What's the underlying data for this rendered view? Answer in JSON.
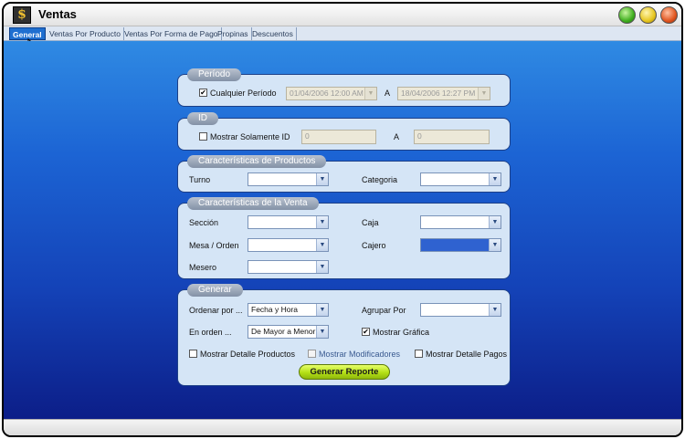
{
  "window": {
    "title": "Ventas",
    "app_icon_glyph": "$"
  },
  "tabs": [
    {
      "label": "General",
      "active": true
    },
    {
      "label": "Ventas Por Producto"
    },
    {
      "label": "Ventas Por Forma de Pago"
    },
    {
      "label": "Propinas"
    },
    {
      "label": "Descuentos"
    }
  ],
  "periodo": {
    "legend": "Período",
    "any_period_label": "Cualquier Período",
    "any_period_checked": true,
    "from_value": "01/04/2006 12:00 AM",
    "to_label": "A",
    "to_value": "18/04/2006 12:27 PM"
  },
  "id": {
    "legend": "ID",
    "only_id_label": "Mostrar Solamente ID",
    "only_id_checked": false,
    "from_value": "0",
    "to_label": "A",
    "to_value": "0"
  },
  "productos": {
    "legend": "Características de Productos",
    "turno_label": "Turno",
    "turno_value": "",
    "categoria_label": "Categoria",
    "categoria_value": ""
  },
  "venta": {
    "legend": "Características de la Venta",
    "seccion_label": "Sección",
    "seccion_value": "",
    "caja_label": "Caja",
    "caja_value": "",
    "mesa_label": "Mesa / Orden",
    "mesa_value": "",
    "cajero_label": "Cajero",
    "cajero_value": "",
    "mesero_label": "Mesero",
    "mesero_value": ""
  },
  "generar": {
    "legend": "Generar",
    "ordenar_label": "Ordenar por ...",
    "ordenar_value": "Fecha y Hora",
    "agrupar_label": "Agrupar Por",
    "agrupar_value": "",
    "orden_label": "En orden ...",
    "orden_value": "De Mayor a Menor",
    "grafica_label": "Mostrar Gráfica",
    "grafica_checked": true,
    "detalle_productos_label": "Mostrar Detalle Productos",
    "modificadores_label": "Mostrar Modificadores",
    "detalle_pagos_label": "Mostrar Detalle Pagos",
    "button_label": "Generar Reporte"
  },
  "colors": {
    "accent": "#1f6fd0",
    "background_top": "#2f8ae3",
    "background_bottom": "#0c1e88",
    "button": "#b4e016"
  },
  "icons": {
    "checkmark": "✔",
    "dropdown": "▼"
  }
}
